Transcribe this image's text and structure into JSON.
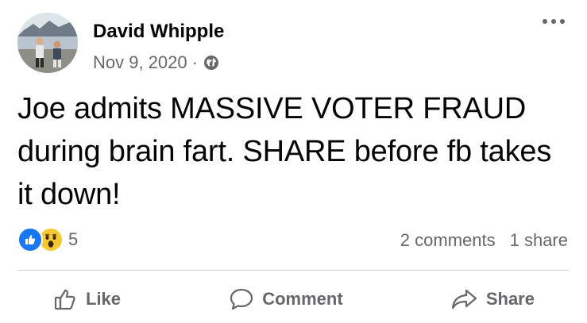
{
  "post": {
    "author": "David Whipple",
    "date": "Nov 9, 2020",
    "separator": "·",
    "privacy_icon": "globe-icon",
    "more_icon": "more-options-icon",
    "text": "Joe admits MASSIVE VOTER FRAUD during brain fart. SHARE before fb takes it down!"
  },
  "reactions": {
    "icons": [
      "like-reaction-icon",
      "wow-reaction-icon"
    ],
    "count": "5"
  },
  "stats": {
    "comments": "2 comments",
    "shares": "1 share"
  },
  "actions": {
    "like_label": "Like",
    "comment_label": "Comment",
    "share_label": "Share"
  },
  "colors": {
    "text": "#050505",
    "secondary_text": "#65676b",
    "like_blue": "#1877f2",
    "wow_yellow": "#f7c830",
    "divider": "#ced0d4"
  }
}
